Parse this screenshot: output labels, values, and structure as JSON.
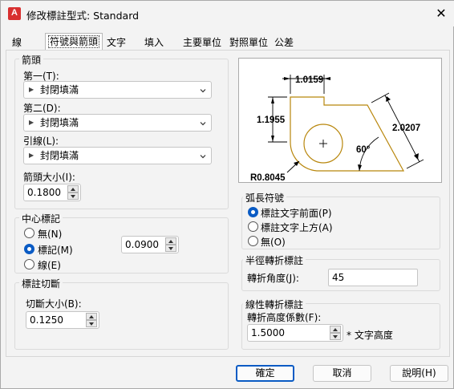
{
  "window": {
    "title": "修改標註型式: Standard",
    "app_icon": "autocad-icon",
    "close_icon": "close-icon"
  },
  "tabs": [
    {
      "label": "線"
    },
    {
      "label": "符號與箭頭"
    },
    {
      "label": "文字"
    },
    {
      "label": "填入"
    },
    {
      "label": "主要單位"
    },
    {
      "label": "對照單位"
    },
    {
      "label": "公差"
    }
  ],
  "arrowheads": {
    "group_label": "箭頭",
    "first_label": "第一(T):",
    "first_value": "封閉填滿",
    "second_label": "第二(D):",
    "second_value": "封閉填滿",
    "leader_label": "引線(L):",
    "leader_value": "封閉填滿",
    "size_label": "箭頭大小(I):",
    "size_value": "0.1800"
  },
  "center_marks": {
    "group_label": "中心標記",
    "options": [
      "無(N)",
      "標記(M)",
      "線(E)"
    ],
    "selected": "標記(M)",
    "size_value": "0.0900"
  },
  "dim_break": {
    "group_label": "標註切斷",
    "size_label": "切斷大小(B):",
    "size_value": "0.1250"
  },
  "preview": {
    "dim_top": "1.0159",
    "dim_left": "1.1955",
    "dim_right": "2.0207",
    "angle": "60°",
    "radius": "R0.8045"
  },
  "arc_length": {
    "group_label": "弧長符號",
    "options": [
      "標註文字前面(P)",
      "標註文字上方(A)",
      "無(O)"
    ],
    "selected": "標註文字前面(P)"
  },
  "radius_jog": {
    "group_label": "半徑轉折標註",
    "angle_label": "轉折角度(J):",
    "angle_value": "45"
  },
  "linear_jog": {
    "group_label": "線性轉折標註",
    "factor_label": "轉折高度係數(F):",
    "factor_value": "1.5000",
    "suffix": "* 文字高度"
  },
  "buttons": {
    "ok": "確定",
    "cancel": "取消",
    "help": "說明(H)"
  },
  "colors": {
    "accent": "#0a5bc4",
    "preview_geometry": "#b8860b",
    "app_icon": "#d83030"
  }
}
